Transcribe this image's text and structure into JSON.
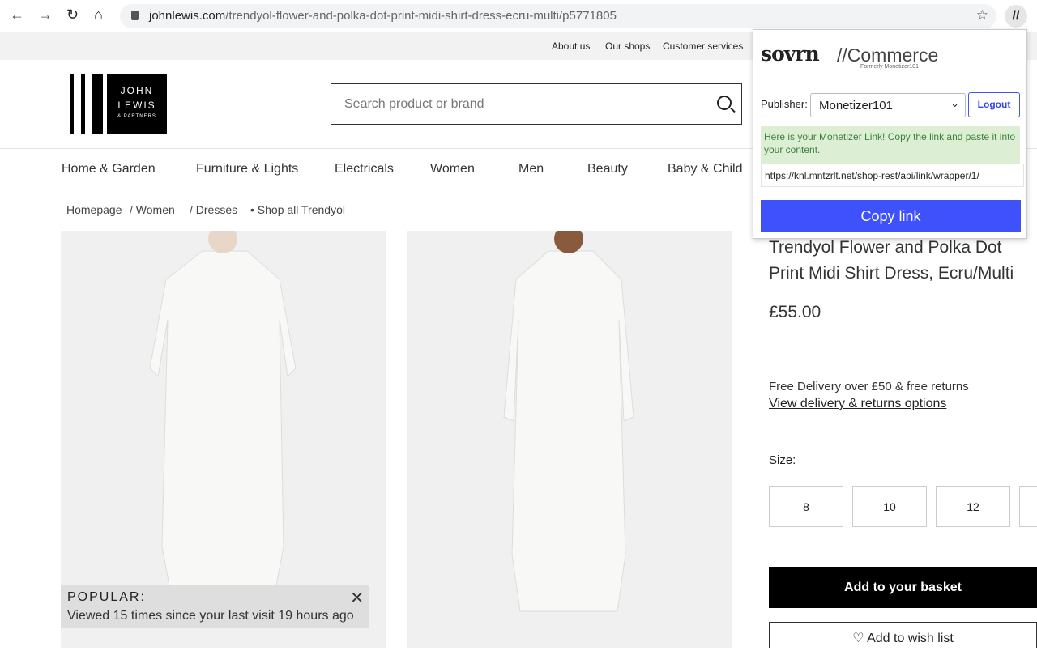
{
  "browser": {
    "url_domain": "johnlewis.com",
    "url_path": "/trendyol-flower-and-polka-dot-print-midi-shirt-dress-ecru-multi/p5771805"
  },
  "topbar": {
    "links": [
      "About us",
      "Our shops",
      "Customer services"
    ]
  },
  "logo": {
    "line1": "JOHN",
    "line2": "LEWIS",
    "line3": "& PARTNERS"
  },
  "search": {
    "placeholder": "Search product or brand"
  },
  "nav": [
    "Home & Garden",
    "Furniture & Lights",
    "Electricals",
    "Women",
    "Men",
    "Beauty",
    "Baby & Child"
  ],
  "breadcrumb": [
    "Homepage",
    "/ Women",
    "/ Dresses",
    "• Shop all Trendyol"
  ],
  "popular": {
    "title": "POPULAR:",
    "text": "Viewed 15 times since your last visit 19 hours ago",
    "close": "✕"
  },
  "product": {
    "title": "Trendyol Flower and Polka Dot Print Midi Shirt Dress, Ecru/Multi",
    "price": "£55.00",
    "delivery": "Free Delivery over £50 & free returns",
    "delivery_link": "View delivery & returns options",
    "size_label": "Size:",
    "sizes": [
      "8",
      "10",
      "12"
    ],
    "basket": "Add to your basket",
    "wishlist": "Add to wish list"
  },
  "extension": {
    "brand": "sovrn",
    "product": "//Commerce",
    "formerly": "Formerly Monetizer101",
    "publisher_label": "Publisher:",
    "publisher_value": "Monetizer101",
    "logout": "Logout",
    "message": "Here is your Monetizer Link! Copy the link and paste it into your content.",
    "link": "https://knl.mntzrlt.net/shop-rest/api/link/wrapper/1/",
    "copy": "Copy link",
    "accent": "#3f51fb"
  }
}
